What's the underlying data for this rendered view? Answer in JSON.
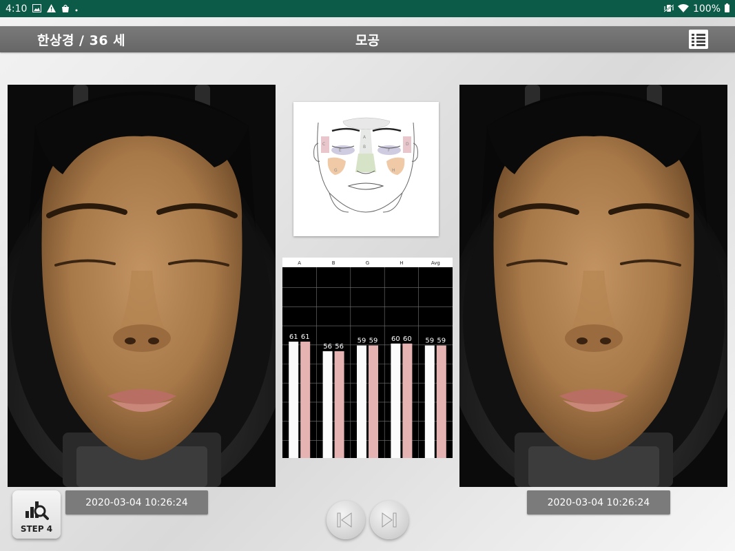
{
  "status_bar": {
    "time": "4:10",
    "battery": "100%",
    "left_icons": [
      "image-icon",
      "warning-icon",
      "shopping-bag-icon",
      "dot-icon"
    ],
    "right_icons": [
      "mute-vibrate-icon",
      "wifi-icon",
      "battery-icon"
    ]
  },
  "header": {
    "patient": "한상경 / 36 세",
    "title": "모공",
    "menu_icon": "list-menu-icon"
  },
  "diagram": {
    "zones": [
      "A",
      "B",
      "C",
      "D",
      "E",
      "F",
      "G",
      "H"
    ]
  },
  "chart_data": {
    "type": "bar",
    "categories": [
      "A",
      "B",
      "G",
      "H",
      "Avg"
    ],
    "series": [
      {
        "values": [
          61,
          56,
          59,
          60,
          59
        ],
        "color": "#fbfbfb"
      },
      {
        "values": [
          61,
          56,
          59,
          60,
          59
        ],
        "color": "#e6b3b3"
      }
    ],
    "ylim": [
      0,
      100
    ],
    "grid": true,
    "background": "#000000",
    "gridline_color": "#777777"
  },
  "left_image": {
    "date": "2020-03-04 10:26:24"
  },
  "right_image": {
    "date": "2020-03-04 10:26:24"
  },
  "step_button": {
    "label": "STEP 4",
    "icon": "chart-search-icon"
  },
  "navigation": {
    "prev_icon": "step-back-icon",
    "next_icon": "step-forward-icon"
  }
}
